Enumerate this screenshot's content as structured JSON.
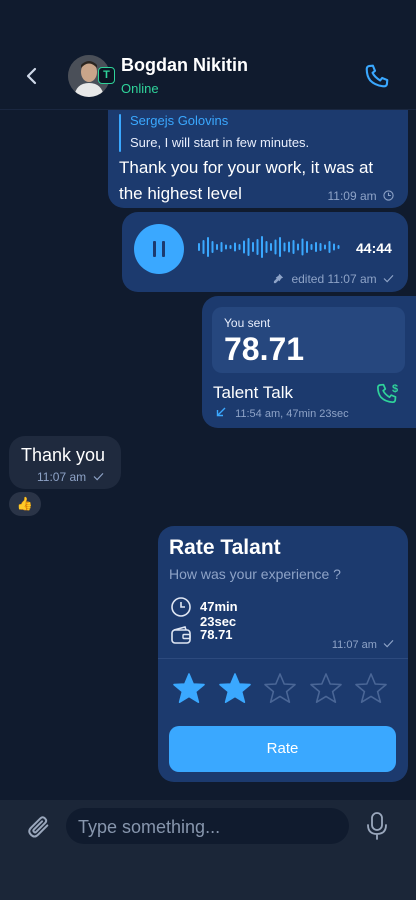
{
  "header": {
    "contact_name": "Bogdan Nikitin",
    "status": "Online",
    "avatar_badge": "T",
    "status_color": "#2fd39a",
    "accent_color": "#3aa8ff"
  },
  "messages": {
    "reply": {
      "quoted_author": "Sergejs Golovins",
      "quoted_text": "Sure, I will start in few minutes.",
      "text": "Thank you for your work, it was at the highest level",
      "time": "11:09 am",
      "status_icon": "clock-icon"
    },
    "voice": {
      "duration": "44:44",
      "edited_label": "edited",
      "time": "11:07 am",
      "status_icon": "check-icon"
    },
    "payment": {
      "label": "You sent",
      "amount": "78.71",
      "service": "Talent Talk",
      "meta": "11:54 am, 47min 23sec"
    },
    "incoming": {
      "text": "Thank you",
      "time": "11:07 am",
      "reaction": "👍"
    },
    "rate_card": {
      "title": "Rate Talant",
      "subtitle": "How was your experience ?",
      "duration": "47min 23sec",
      "amount": "78.71",
      "time": "11:07 am",
      "rating": 2,
      "max_rating": 5,
      "button_label": "Rate"
    }
  },
  "composer": {
    "placeholder": "Type something..."
  }
}
